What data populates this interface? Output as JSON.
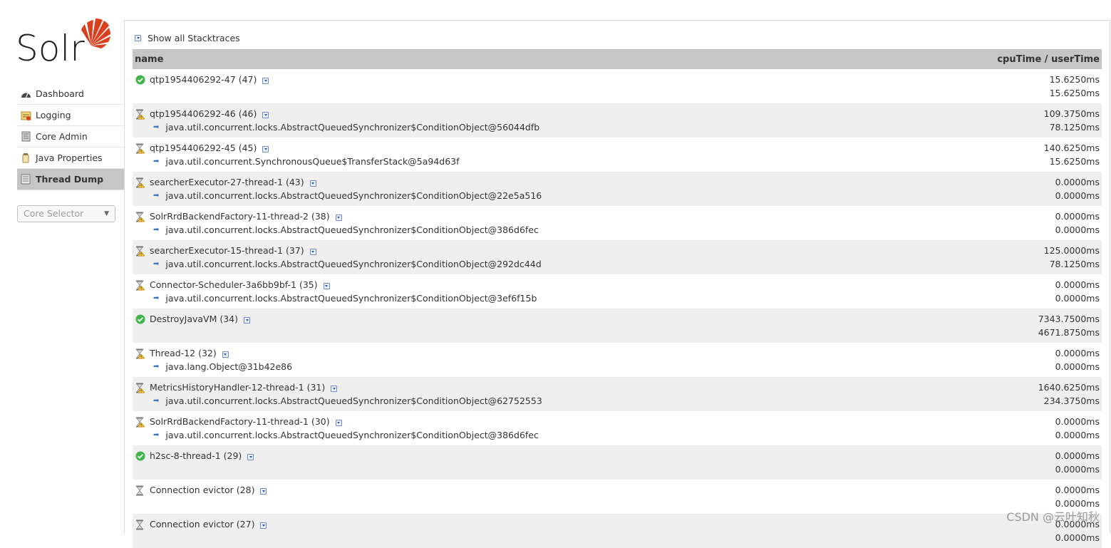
{
  "logo": {
    "text": "Solr"
  },
  "sidebar": {
    "items": [
      {
        "label": "Dashboard",
        "icon": "dashboard-icon"
      },
      {
        "label": "Logging",
        "icon": "logging-icon"
      },
      {
        "label": "Core Admin",
        "icon": "core-admin-icon"
      },
      {
        "label": "Java Properties",
        "icon": "java-properties-icon"
      },
      {
        "label": "Thread Dump",
        "icon": "thread-dump-icon",
        "active": true
      }
    ],
    "core_selector": {
      "placeholder": "Core Selector"
    }
  },
  "main": {
    "toggle_label": "Show all Stacktraces",
    "columns": {
      "name": "name",
      "times": "cpuTime / userTime"
    },
    "threads": [
      {
        "name": "qtp1954406292-47 (47)",
        "state": "running",
        "lock": "",
        "cpu": "15.6250ms",
        "user": "15.6250ms"
      },
      {
        "name": "qtp1954406292-46 (46)",
        "state": "waiting",
        "lock": "java.util.concurrent.locks.AbstractQueuedSynchronizer$ConditionObject@56044dfb",
        "cpu": "109.3750ms",
        "user": "78.1250ms"
      },
      {
        "name": "qtp1954406292-45 (45)",
        "state": "waiting",
        "lock": "java.util.concurrent.SynchronousQueue$TransferStack@5a94d63f",
        "cpu": "140.6250ms",
        "user": "15.6250ms"
      },
      {
        "name": "searcherExecutor-27-thread-1 (43)",
        "state": "waiting",
        "lock": "java.util.concurrent.locks.AbstractQueuedSynchronizer$ConditionObject@22e5a516",
        "cpu": "0.0000ms",
        "user": "0.0000ms"
      },
      {
        "name": "SolrRrdBackendFactory-11-thread-2 (38)",
        "state": "waiting",
        "lock": "java.util.concurrent.locks.AbstractQueuedSynchronizer$ConditionObject@386d6fec",
        "cpu": "0.0000ms",
        "user": "0.0000ms"
      },
      {
        "name": "searcherExecutor-15-thread-1 (37)",
        "state": "waiting",
        "lock": "java.util.concurrent.locks.AbstractQueuedSynchronizer$ConditionObject@292dc44d",
        "cpu": "125.0000ms",
        "user": "78.1250ms"
      },
      {
        "name": "Connector-Scheduler-3a6bb9bf-1 (35)",
        "state": "waiting",
        "lock": "java.util.concurrent.locks.AbstractQueuedSynchronizer$ConditionObject@3ef6f15b",
        "cpu": "0.0000ms",
        "user": "0.0000ms"
      },
      {
        "name": "DestroyJavaVM (34)",
        "state": "running",
        "lock": "",
        "cpu": "7343.7500ms",
        "user": "4671.8750ms"
      },
      {
        "name": "Thread-12 (32)",
        "state": "waiting",
        "lock": "java.lang.Object@31b42e86",
        "cpu": "0.0000ms",
        "user": "0.0000ms"
      },
      {
        "name": "MetricsHistoryHandler-12-thread-1 (31)",
        "state": "waiting",
        "lock": "java.util.concurrent.locks.AbstractQueuedSynchronizer$ConditionObject@62752553",
        "cpu": "1640.6250ms",
        "user": "234.3750ms"
      },
      {
        "name": "SolrRrdBackendFactory-11-thread-1 (30)",
        "state": "waiting",
        "lock": "java.util.concurrent.locks.AbstractQueuedSynchronizer$ConditionObject@386d6fec",
        "cpu": "0.0000ms",
        "user": "0.0000ms"
      },
      {
        "name": "h2sc-8-thread-1 (29)",
        "state": "running",
        "lock": "",
        "cpu": "0.0000ms",
        "user": "0.0000ms"
      },
      {
        "name": "Connection evictor (28)",
        "state": "timed-waiting",
        "lock": "",
        "cpu": "0.0000ms",
        "user": "0.0000ms"
      },
      {
        "name": "Connection evictor (27)",
        "state": "timed-waiting",
        "lock": "",
        "cpu": "0.0000ms",
        "user": "0.0000ms"
      }
    ]
  },
  "watermark": "CSDN @云叶知秋",
  "colors": {
    "header_bg": "#c6c6c6",
    "alt_row": "#efefef",
    "brand": "#d9411e",
    "running": "#3cb54a",
    "link_arrow": "#3a78c9"
  }
}
